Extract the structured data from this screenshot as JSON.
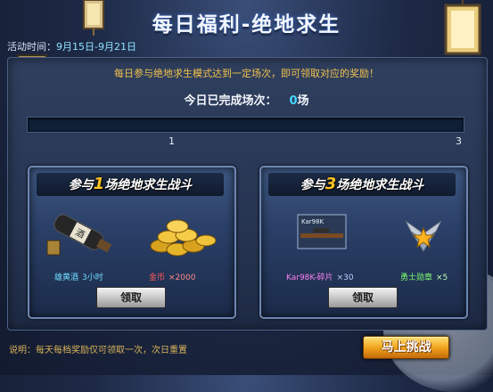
{
  "header": {
    "title": "每日福利-绝地求生",
    "period_label": "活动时间：",
    "period_value": "9月15日-9月21日"
  },
  "intro": "每日参与绝地求生模式达到一定场次，即可领取对应的奖励！",
  "progress": {
    "label": "今日已完成场次：",
    "value": "0",
    "unit": "场",
    "fraction": 0,
    "ticks": [
      "1",
      "3"
    ]
  },
  "cards": [
    {
      "title_prefix": "参与",
      "title_number": "1",
      "title_suffix": "场绝地求生战斗",
      "items": [
        {
          "name": "雄黄酒",
          "qty": "3小时",
          "icon": "wine-bottle-icon"
        },
        {
          "name": "金币",
          "qty": "×2000",
          "icon": "gold-coins-icon"
        }
      ],
      "button": "领取"
    },
    {
      "title_prefix": "参与",
      "title_number": "3",
      "title_suffix": "场绝地求生战斗",
      "items": [
        {
          "name": "Kar98K-碎片",
          "qty": "×30",
          "icon": "rifle-icon",
          "icon_text": "Kar98K"
        },
        {
          "name": "勇士勋章",
          "qty": "×5",
          "icon": "medal-icon"
        }
      ],
      "button": "领取"
    }
  ],
  "footer": {
    "note": "说明：每天每档奖励仅可领取一次，次日重置",
    "challenge_button": "马上挑战"
  },
  "colors": {
    "accent_cyan": "#46d8ff",
    "gold": "#ffc423",
    "intro_text": "#f2c14d"
  }
}
